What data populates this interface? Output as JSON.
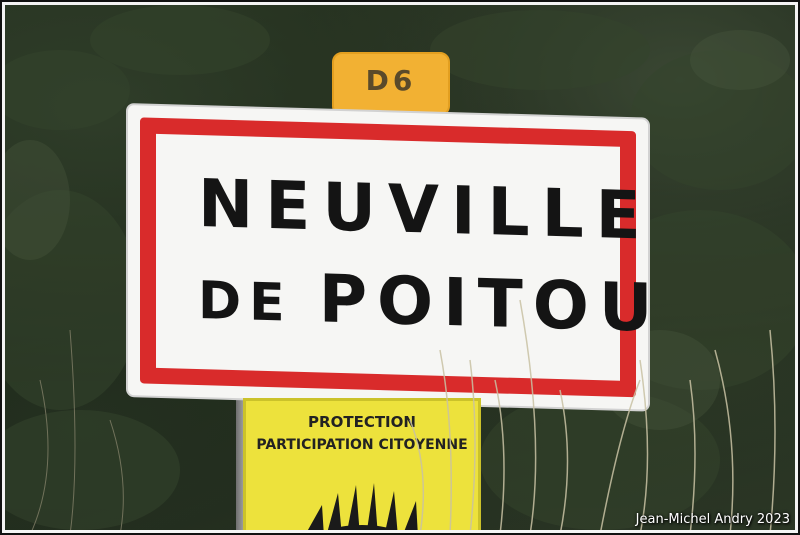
{
  "route_plate": {
    "text": "D6"
  },
  "town_sign": {
    "line_1": "NEUVILLE",
    "line_2_small": "DE",
    "line_2_big": "POITOU"
  },
  "yellow_sign": {
    "line_1": "PROTECTION",
    "line_2": "PARTICIPATION CITOYENNE"
  },
  "photo_credit": "Jean-Michel Andry 2023",
  "colors": {
    "sign_red": "#d92b2b",
    "route_plate": "#f2b133",
    "yellow_sign": "#ede23c"
  }
}
